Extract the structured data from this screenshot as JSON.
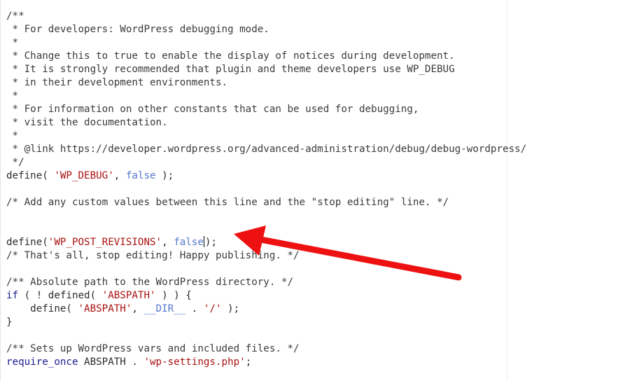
{
  "editor": {
    "lines": [
      [
        {
          "t": "/**",
          "c": "cm"
        }
      ],
      [
        {
          "t": " * For developers: WordPress debugging mode.",
          "c": "cm"
        }
      ],
      [
        {
          "t": " *",
          "c": "cm"
        }
      ],
      [
        {
          "t": " * Change this to true to enable the display of notices during development.",
          "c": "cm"
        }
      ],
      [
        {
          "t": " * It is strongly recommended that plugin and theme developers use WP_DEBUG",
          "c": "cm"
        }
      ],
      [
        {
          "t": " * in their development environments.",
          "c": "cm"
        }
      ],
      [
        {
          "t": " *",
          "c": "cm"
        }
      ],
      [
        {
          "t": " * For information on other constants that can be used for debugging,",
          "c": "cm"
        }
      ],
      [
        {
          "t": " * visit the documentation.",
          "c": "cm"
        }
      ],
      [
        {
          "t": " *",
          "c": "cm"
        }
      ],
      [
        {
          "t": " * @link https://developer.wordpress.org/advanced-administration/debug/debug-wordpress/",
          "c": "cm"
        }
      ],
      [
        {
          "t": " */",
          "c": "cm"
        }
      ],
      [
        {
          "t": "define( ",
          "c": "fn"
        },
        {
          "t": "'WP_DEBUG'",
          "c": "str"
        },
        {
          "t": ", ",
          "c": "fn"
        },
        {
          "t": "false",
          "c": "atom"
        },
        {
          "t": " );",
          "c": "fn"
        }
      ],
      [],
      [
        {
          "t": "/* Add any custom values between this line and the \"stop editing\" line. */",
          "c": "cm"
        }
      ],
      [],
      [],
      [
        {
          "t": "define(",
          "c": "fn"
        },
        {
          "t": "'WP_POST_REVISIONS'",
          "c": "str"
        },
        {
          "t": ", ",
          "c": "fn"
        },
        {
          "t": "false",
          "c": "atom"
        },
        {
          "t": "|caret|",
          "c": "caret"
        },
        {
          "t": ");",
          "c": "fn"
        }
      ],
      [
        {
          "t": "/* That's all, stop editing! Happy publishing. */",
          "c": "cm"
        }
      ],
      [],
      [
        {
          "t": "/** Absolute path to the WordPress directory. */",
          "c": "cm"
        }
      ],
      [
        {
          "t": "if",
          "c": "kw"
        },
        {
          "t": " ( ! defined( ",
          "c": "fn"
        },
        {
          "t": "'ABSPATH'",
          "c": "str"
        },
        {
          "t": " ) ) {",
          "c": "fn"
        }
      ],
      [
        {
          "t": "    define( ",
          "c": "fn"
        },
        {
          "t": "'ABSPATH'",
          "c": "str"
        },
        {
          "t": ", ",
          "c": "fn"
        },
        {
          "t": "__DIR__",
          "c": "const"
        },
        {
          "t": " . ",
          "c": "fn"
        },
        {
          "t": "'/'",
          "c": "str"
        },
        {
          "t": " );",
          "c": "fn"
        }
      ],
      [
        {
          "t": "}",
          "c": "fn"
        }
      ],
      [],
      [
        {
          "t": "/** Sets up WordPress vars and included files. */",
          "c": "cm"
        }
      ],
      [
        {
          "t": "require_once",
          "c": "kw"
        },
        {
          "t": " ABSPATH . ",
          "c": "fn"
        },
        {
          "t": "'wp-settings.php'",
          "c": "str"
        },
        {
          "t": ";",
          "c": "fn"
        }
      ]
    ],
    "active_line": 17,
    "colors": {
      "annotation_arrow": "#ee1111",
      "active_line_bg": "#ececec"
    }
  }
}
